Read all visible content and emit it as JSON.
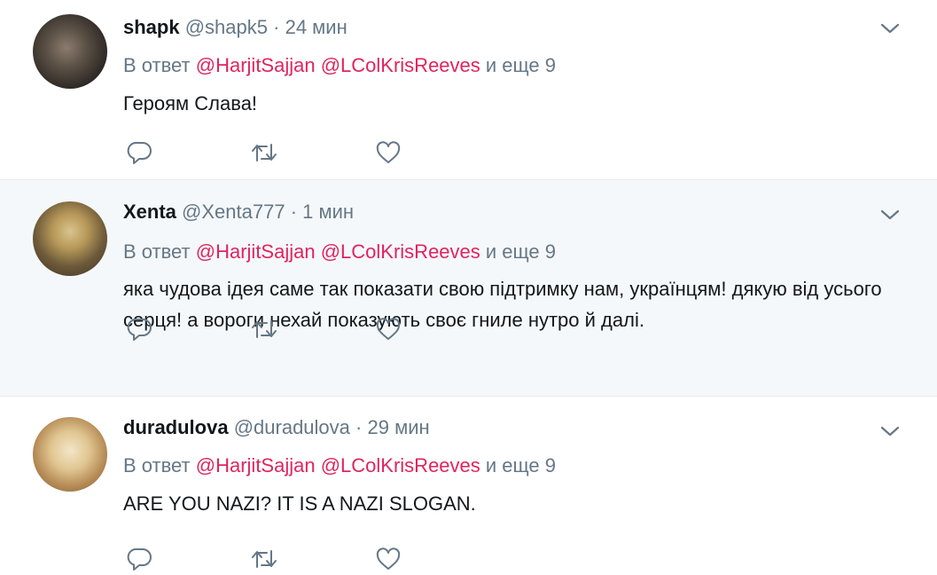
{
  "colors": {
    "name": "#14171a",
    "meta": "#657786",
    "mention": "#e0245e",
    "highlight_bg": "#f5f8fa",
    "divider": "#e6ecf0"
  },
  "tweets": [
    {
      "name": "shapk",
      "handle": "@shapk5",
      "dot": "·",
      "time": "24 мин",
      "reply_prefix": "В ответ",
      "mention1": "@HarjitSajjan",
      "mention2": "@LColKrisReeves",
      "reply_suffix": "и еще 9",
      "text": "Героям Слава!"
    },
    {
      "name": "Xenta",
      "handle": "@Xenta777",
      "dot": "·",
      "time": "1 мин",
      "reply_prefix": "В ответ",
      "mention1": "@HarjitSajjan",
      "mention2": "@LColKrisReeves",
      "reply_suffix": "и еще 9",
      "text": "яка чудова ідея саме так показати свою підтримку нам, українцям! дякую від усього серця! а вороги нехай показують своє гниле нутро й далі."
    },
    {
      "name": "duradulova",
      "handle": "@duradulova",
      "dot": "·",
      "time": "29 мин",
      "reply_prefix": "В ответ",
      "mention1": "@HarjitSajjan",
      "mention2": "@LColKrisReeves",
      "reply_suffix": "и еще 9",
      "text": "ARE YOU NAZI? IT IS A NAZI SLOGAN."
    }
  ],
  "icons": {
    "reply": "reply-icon",
    "retweet": "retweet-icon",
    "like": "heart-icon",
    "menu": "chevron-down-icon"
  }
}
